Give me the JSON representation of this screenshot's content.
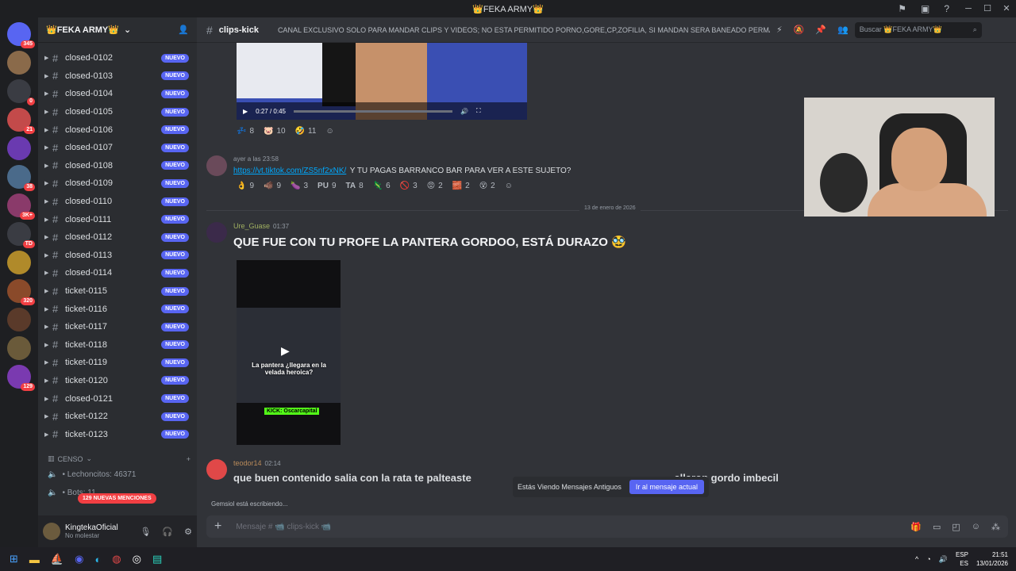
{
  "window": {
    "title": "👑FEKA ARMY👑"
  },
  "server": {
    "name": "👑FEKA ARMY👑"
  },
  "guilds": [
    {
      "badge": "345"
    },
    {
      "badge": ""
    },
    {
      "badge": "0"
    },
    {
      "badge": "21"
    },
    {
      "badge": ""
    },
    {
      "badge": "38"
    },
    {
      "badge": "3K+"
    },
    {
      "badge": "TD"
    },
    {
      "badge": ""
    },
    {
      "badge": "320"
    },
    {
      "badge": ""
    },
    {
      "badge": ""
    },
    {
      "badge": "129"
    }
  ],
  "channels": [
    {
      "name": "closed-0102",
      "badge": "NUEVO"
    },
    {
      "name": "closed-0103",
      "badge": "NUEVO"
    },
    {
      "name": "closed-0104",
      "badge": "NUEVO"
    },
    {
      "name": "closed-0105",
      "badge": "NUEVO"
    },
    {
      "name": "closed-0106",
      "badge": "NUEVO"
    },
    {
      "name": "closed-0107",
      "badge": "NUEVO"
    },
    {
      "name": "closed-0108",
      "badge": "NUEVO"
    },
    {
      "name": "closed-0109",
      "badge": "NUEVO"
    },
    {
      "name": "closed-0110",
      "badge": "NUEVO"
    },
    {
      "name": "closed-0111",
      "badge": "NUEVO"
    },
    {
      "name": "closed-0112",
      "badge": "NUEVO"
    },
    {
      "name": "closed-0113",
      "badge": "NUEVO"
    },
    {
      "name": "closed-0114",
      "badge": "NUEVO"
    },
    {
      "name": "ticket-0115",
      "badge": "NUEVO"
    },
    {
      "name": "ticket-0116",
      "badge": "NUEVO"
    },
    {
      "name": "ticket-0117",
      "badge": "NUEVO"
    },
    {
      "name": "ticket-0118",
      "badge": "NUEVO"
    },
    {
      "name": "ticket-0119",
      "badge": "NUEVO"
    },
    {
      "name": "ticket-0120",
      "badge": "NUEVO"
    },
    {
      "name": "closed-0121",
      "badge": "NUEVO"
    },
    {
      "name": "ticket-0122",
      "badge": "NUEVO"
    },
    {
      "name": "ticket-0123",
      "badge": "NUEVO"
    }
  ],
  "category": {
    "name": "CENSO"
  },
  "voice": {
    "item1": "• Lechoncitos: 46371",
    "item2": "• Bots: 11"
  },
  "new_mentions": "129 NUEVAS MENCIONES",
  "user": {
    "name": "KingtekaOficial",
    "status": "No molestar"
  },
  "chat": {
    "channel": "clips-kick",
    "topic": "CANAL EXCLUSIVO SOLO PARA MANDAR CLIPS Y VIDEOS; NO ESTA PERMITIDO PORNO,GORE,CP,ZOFILIA, SI MANDAN SERA BANEADO PERMA...",
    "search_placeholder": "Buscar 👑FEKA ARMY👑",
    "video1_time": "0:27 / 0:45",
    "reactions1": [
      {
        "emoji": "💤",
        "count": "8"
      },
      {
        "emoji": "🐷",
        "count": "10"
      },
      {
        "emoji": "🤣",
        "count": "11"
      }
    ],
    "msg1": {
      "time": "ayer a las 23:58",
      "link": "https://vt.tiktok.com/ZS5nf2xNK/",
      "text": "Y TU PAGAS BARRANCO BAR PARA VER A ESTE SUJETO?"
    },
    "reactions2": [
      {
        "emoji": "👌",
        "count": "9"
      },
      {
        "emoji": "🐗",
        "count": "9"
      },
      {
        "emoji": "🍆",
        "count": "3"
      },
      {
        "emoji": "PU",
        "count": "9"
      },
      {
        "emoji": "TA",
        "count": "8"
      },
      {
        "emoji": "🦎",
        "count": "6"
      },
      {
        "emoji": "🚫",
        "count": "3"
      },
      {
        "emoji": "😡",
        "count": "2"
      },
      {
        "emoji": "🧱",
        "count": "2"
      },
      {
        "emoji": "😵",
        "count": "2"
      }
    ],
    "date_divider": "13 de enero de 2026",
    "msg2": {
      "author": "Ure_Guase",
      "time": "01:37",
      "text": "QUE FUE CON TU PROFE LA PANTERA GORDOO, ESTÁ DURAZO 🥸"
    },
    "video2": {
      "caption": "La pantera ¿llegara en la velada heroica?",
      "tag": "KICK: Oscarcapital"
    },
    "msg3": {
      "author": "teodor14",
      "time": "02:14",
      "text": "que buen contenido salia con la rata te palteaste",
      "text_tail": "allaron gordo imbecil"
    },
    "banner": {
      "text": "Estás Viendo Mensajes Antiguos",
      "button": "Ir al mensaje actual"
    },
    "typing": "Gemsiol está escribiendo...",
    "composer_placeholder": "Mensaje # 📹 clips-kick 📹"
  },
  "taskbar": {
    "lang1": "ESP",
    "lang2": "ES",
    "time": "21:51",
    "date": "13/01/2026"
  }
}
